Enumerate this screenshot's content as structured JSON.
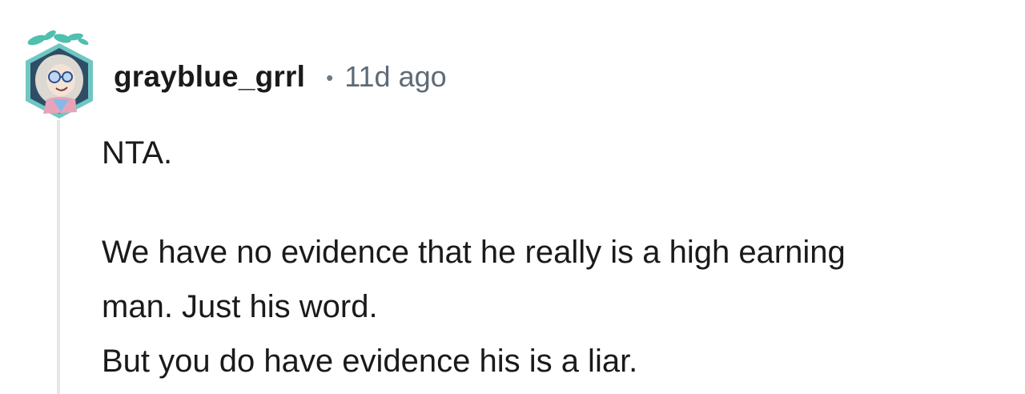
{
  "comment": {
    "username": "grayblue_grrl",
    "separator": "•",
    "timestamp": "11d ago",
    "avatar_icon": "snoo-avatar-icon",
    "body": {
      "paragraph_1": "NTA.",
      "paragraph_2_lines": [
        "We have no evidence that he really is a high earning",
        "man. Just his word.",
        "But you do have evidence his is a liar."
      ]
    }
  },
  "colors": {
    "username": "#1a1a1b",
    "timestamp": "#5c6b77",
    "text": "#1a1a1b",
    "thread_line": "#e5e7e9",
    "avatar_border": "#6fc7c4"
  }
}
